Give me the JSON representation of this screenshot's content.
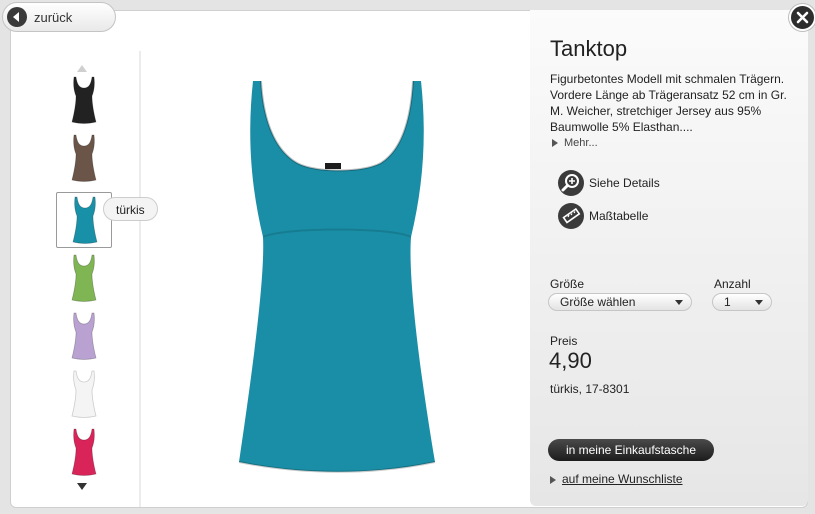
{
  "nav": {
    "back_label": "zurück"
  },
  "thumbnails": [
    {
      "color": "#222222",
      "selected": false
    },
    {
      "color": "#6b5548",
      "selected": false
    },
    {
      "color": "#1891a8",
      "selected": true
    },
    {
      "color": "#7fb553",
      "selected": false
    },
    {
      "color": "#b9a2d2",
      "selected": false
    },
    {
      "color": "#f4f4f4",
      "selected": false
    },
    {
      "color": "#d9245a",
      "selected": false
    }
  ],
  "tooltip": {
    "label": "türkis"
  },
  "product": {
    "title": "Tanktop",
    "description": "Figurbetontes Modell mit schmalen Trägern. Vordere Länge ab Trägeransatz 52 cm in Gr. M. Weicher, stretchiger Jersey aus 95% Baumwolle 5% Elasthan....",
    "more_label": "Mehr...",
    "main_color": "#1a8ea6",
    "details_label": "Siehe Details",
    "size_chart_label": "Maßtabelle",
    "size_label": "Größe",
    "size_value": "Größe wählen",
    "qty_label": "Anzahl",
    "qty_value": "1",
    "price_label": "Preis",
    "price": "4,90",
    "variant": "türkis, 17-8301",
    "cart_button": "in meine Einkaufstasche",
    "wishlist_link": "auf meine Wunschliste"
  },
  "icons": {
    "back": "arrow-left-icon",
    "close": "close-icon",
    "details": "magnifier-plus-icon",
    "size_chart": "ruler-icon"
  }
}
